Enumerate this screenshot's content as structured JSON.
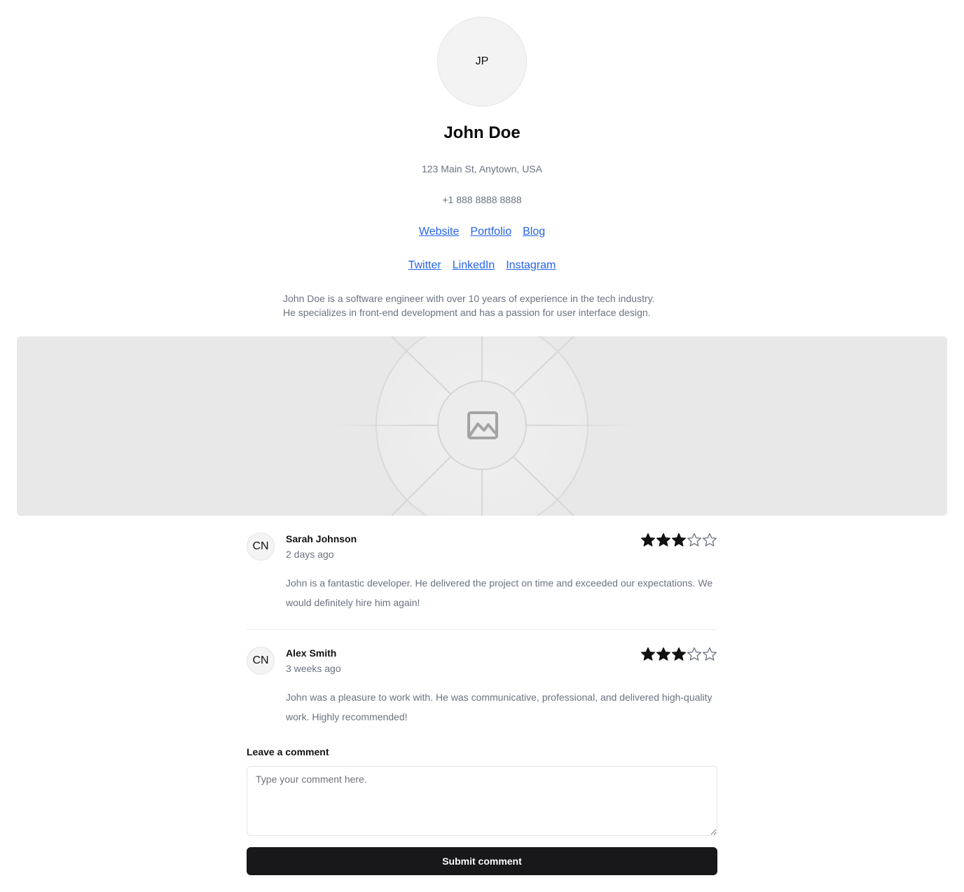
{
  "profile": {
    "initials": "JP",
    "name": "John Doe",
    "address": "123 Main St, Anytown, USA",
    "phone": "+1 888 8888 8888",
    "links": [
      "Website",
      "Portfolio",
      "Blog"
    ],
    "social": [
      "Twitter",
      "LinkedIn",
      "Instagram"
    ],
    "bio_lines": [
      "John Doe is a software engineer with over 10 years of experience in the tech industry.",
      "He specializes in front-end development and has a passion for user interface design."
    ]
  },
  "banner": {
    "icon": "image-placeholder-icon"
  },
  "reviews": [
    {
      "initials": "CN",
      "name": "Sarah Johnson",
      "when": "2 days ago",
      "rating": 3,
      "max_rating": 5,
      "text": "John is a fantastic developer. He delivered the project on time and exceeded our expectations. We would definitely hire him again!"
    },
    {
      "initials": "CN",
      "name": "Alex Smith",
      "when": "3 weeks ago",
      "rating": 3,
      "max_rating": 5,
      "text": "John was a pleasure to work with. He was communicative, professional, and delivered high-quality work. Highly recommended!"
    }
  ],
  "comment": {
    "label": "Leave a comment",
    "placeholder": "Type your comment here.",
    "submit_label": "Submit comment"
  },
  "colors": {
    "link": "#2563eb",
    "button": "#18181b",
    "muted": "#6b7280",
    "banner": "#e8e8e8"
  }
}
